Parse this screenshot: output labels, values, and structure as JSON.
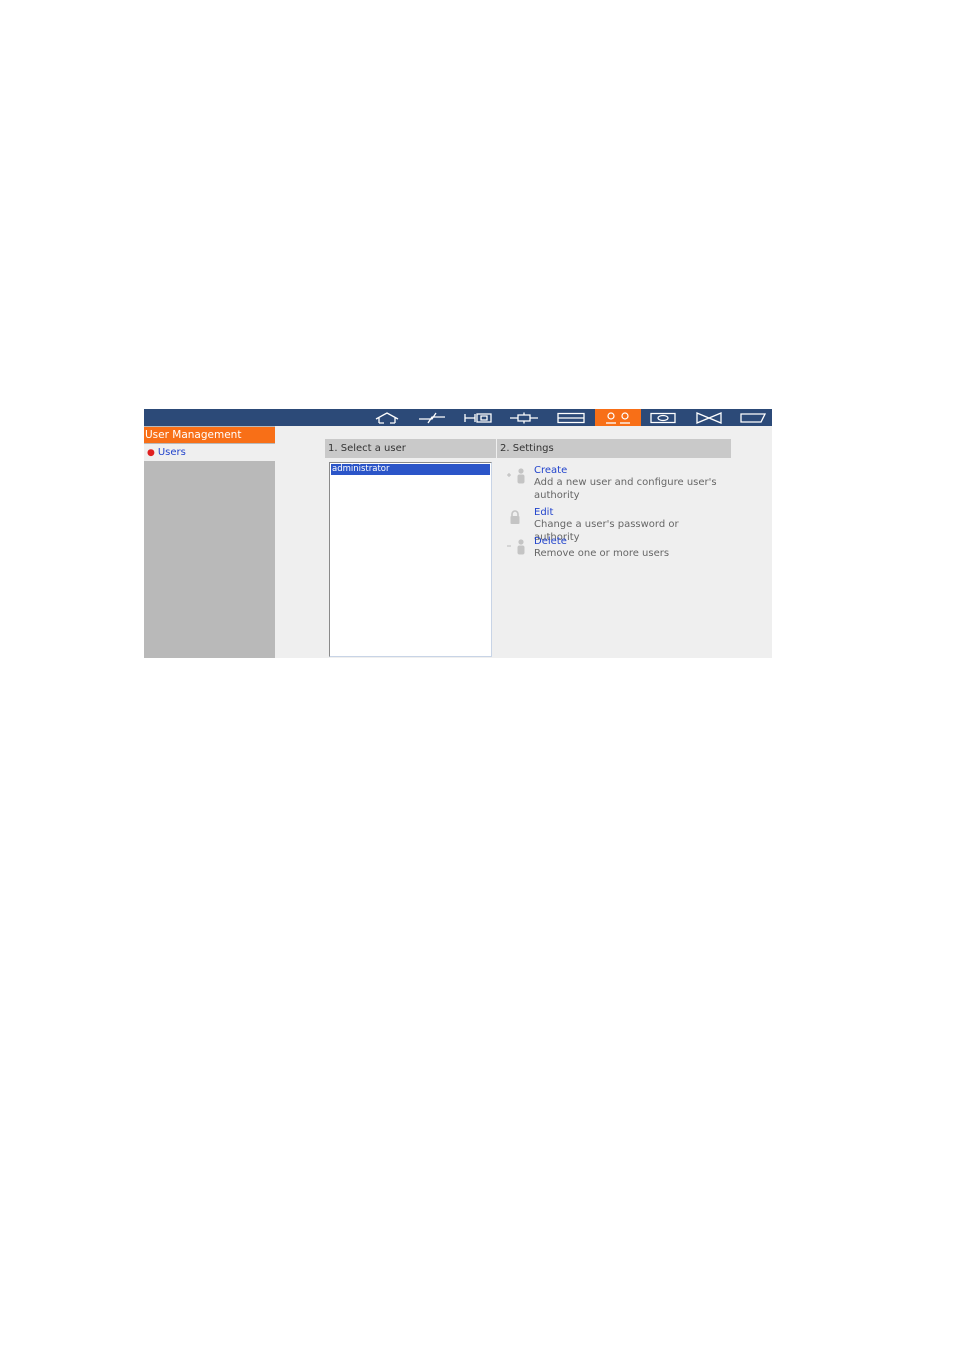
{
  "topbar": {
    "icons": [
      {
        "name": "home-icon"
      },
      {
        "name": "system-settings-icon"
      },
      {
        "name": "privilege-settings-icon"
      },
      {
        "name": "network-services-icon"
      },
      {
        "name": "storage-icon"
      },
      {
        "name": "user-management-icon",
        "active": true
      },
      {
        "name": "monitor-icon"
      },
      {
        "name": "share-icon"
      },
      {
        "name": "tag-icon"
      }
    ],
    "colors": {
      "bar": "#2c4a78",
      "active": "#f86f17"
    }
  },
  "sidebar": {
    "header": "User Management",
    "items": [
      {
        "label": "Users"
      }
    ]
  },
  "select_user": {
    "title": "1. Select a user",
    "users": [
      "administrator"
    ]
  },
  "settings": {
    "title": "2. Settings",
    "actions": [
      {
        "label": "Create",
        "description": "Add a new user and configure user's authority",
        "icon": "add-user-icon"
      },
      {
        "label": "Edit",
        "description": "Change a user's password or authority",
        "icon": "lock-icon"
      },
      {
        "label": "Delete",
        "description": "Remove one or more users",
        "icon": "remove-user-icon"
      }
    ]
  }
}
